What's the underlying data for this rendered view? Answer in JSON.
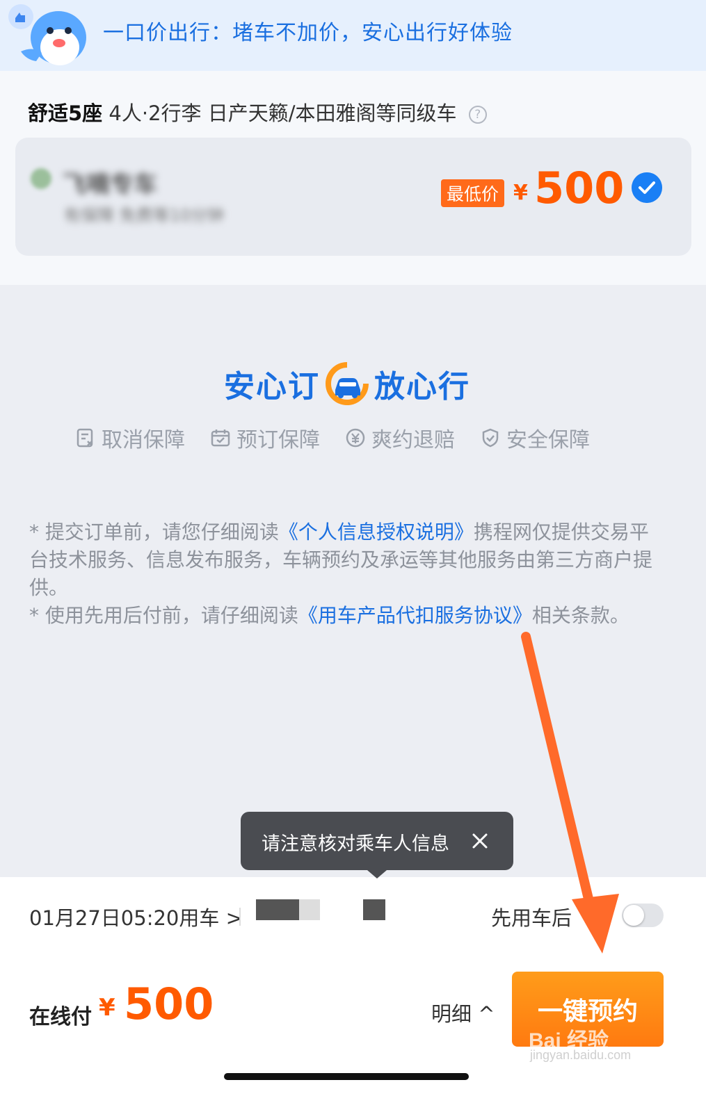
{
  "banner": {
    "text": "一口价出行：堵车不加价，安心出行好体验",
    "mascot_icon": "dolphin-mascot-icon"
  },
  "vehicle": {
    "class_name": "舒适5座",
    "capacity": "4人·2行李",
    "models": "日产天籁/本田雅阁等同级车",
    "help_icon": "question-circle-icon"
  },
  "provider": {
    "name": "飞嘀专车",
    "desc": "有保障    免费等10分钟",
    "badge": "最低价",
    "currency": "¥",
    "price": "500",
    "selected": true
  },
  "assurance": {
    "left": "安心订",
    "right": "放心行",
    "items": [
      {
        "label": "取消保障",
        "icon": "cancel-receipt-icon"
      },
      {
        "label": "预订保障",
        "icon": "calendar-icon"
      },
      {
        "label": "爽约退赔",
        "icon": "yuan-refund-icon"
      },
      {
        "label": "安全保障",
        "icon": "shield-icon"
      }
    ]
  },
  "notice": {
    "line1_pre": "* 提交订单前，请您仔细阅读",
    "line1_link": "《个人信息授权说明》",
    "line1_post": "携程网仅提供交易平台技术服务、信息发布服务，车辆预约及承运等其他服务由第三方商户提供。",
    "line2_pre": "* 使用先用后付前，请仔细阅读",
    "line2_link": "《用车产品代扣服务协议》",
    "line2_post": "相关条款。"
  },
  "tooltip": {
    "text": "请注意核对乘车人信息"
  },
  "bottom": {
    "datetime": "01月27日05:20用车",
    "paylater": "先用车后",
    "paylater_enabled": false,
    "pay_label": "在线付",
    "currency": "¥",
    "price": "500",
    "detail": "明细",
    "book_button": "一键预约"
  },
  "watermark": {
    "brand": "Bai  经验",
    "url": "jingyan.baidu.com"
  },
  "colors": {
    "primary_blue": "#1a6fe0",
    "price_orange": "#ff5a00",
    "button_orange": "#ff8a14"
  }
}
